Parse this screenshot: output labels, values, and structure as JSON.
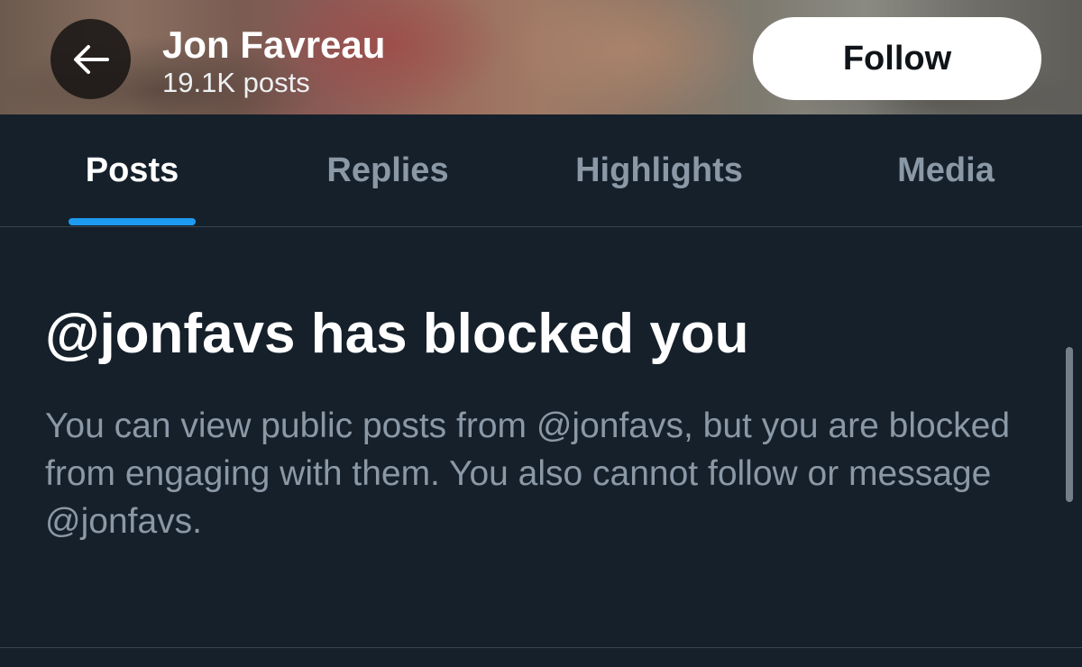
{
  "header": {
    "profile_name": "Jon Favreau",
    "post_count": "19.1K posts",
    "follow_label": "Follow",
    "back_icon": "arrow-left-icon"
  },
  "tabs": [
    {
      "label": "Posts",
      "active": true
    },
    {
      "label": "Replies",
      "active": false
    },
    {
      "label": "Highlights",
      "active": false
    },
    {
      "label": "Media",
      "active": false
    }
  ],
  "blocked": {
    "title": "@jonfavs has blocked you",
    "body": "You can view public posts from @jonfavs, but you are blocked from engaging with them. You also cannot follow or message @jonfavs."
  },
  "colors": {
    "background": "#15202b",
    "accent": "#1d9bf0",
    "secondary_text": "#8b98a5",
    "divider": "#38444d"
  }
}
